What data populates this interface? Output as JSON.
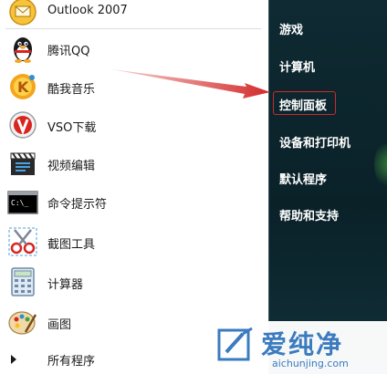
{
  "start_menu": {
    "programs": [
      {
        "label": "Outlook 2007",
        "icon": "outlook-icon"
      },
      {
        "label": "腾讯QQ",
        "icon": "qq-penguin-icon"
      },
      {
        "label": "酷我音乐",
        "icon": "kuwo-music-icon"
      },
      {
        "label": "VSO下载",
        "icon": "vso-download-icon"
      },
      {
        "label": "视频编辑",
        "icon": "video-edit-icon"
      },
      {
        "label": "命令提示符",
        "icon": "command-prompt-icon"
      },
      {
        "label": "截图工具",
        "icon": "snipping-tool-icon"
      },
      {
        "label": "计算器",
        "icon": "calculator-icon"
      },
      {
        "label": "画图",
        "icon": "paint-icon"
      }
    ],
    "all_programs_label": "所有程序",
    "right_items": [
      {
        "label": "游戏"
      },
      {
        "label": "计算机"
      },
      {
        "label": "控制面板",
        "highlighted": true
      },
      {
        "label": "设备和打印机"
      },
      {
        "label": "默认程序"
      },
      {
        "label": "帮助和支持"
      }
    ]
  },
  "annotation": {
    "arrow_color": "#d42a2a",
    "target": "控制面板"
  },
  "watermark": {
    "name": "爱纯净",
    "url": "aichunjing.com",
    "color": "#3b7bbf"
  }
}
